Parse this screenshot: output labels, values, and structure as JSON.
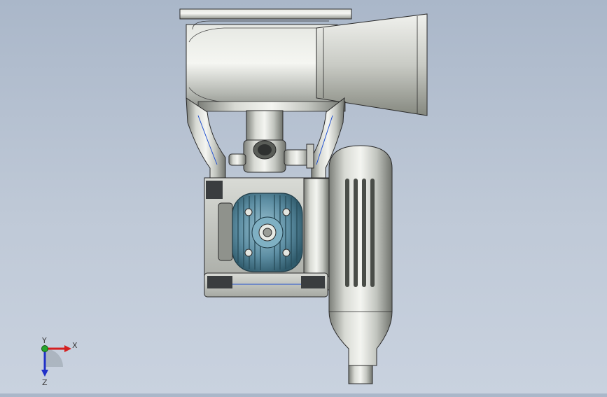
{
  "colors": {
    "background_top": "#aab7c9",
    "background_bottom": "#c9d2df",
    "metal_light": "#eef0ec",
    "metal_mid": "#b9bcb6",
    "metal_dark": "#6e716b",
    "cylinder_blue": "#5d8ea3",
    "cylinder_blue_dark": "#2f5a6b",
    "bracket_dark": "#3a3d3f",
    "axis_x": "#d42020",
    "axis_y": "#27a52c",
    "axis_z": "#2030c8"
  },
  "triad": {
    "x_label": "X",
    "y_label": "Y",
    "z_label": "Z"
  }
}
